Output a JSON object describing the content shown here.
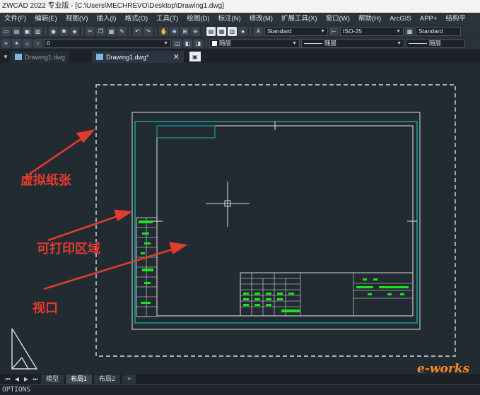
{
  "window": {
    "title": "ZWCAD 2022 专业版 - [C:\\Users\\MECHREVO\\Desktop\\Drawing1.dwg]"
  },
  "menu": [
    "文件(F)",
    "编辑(E)",
    "视图(V)",
    "插入(I)",
    "格式(O)",
    "工具(T)",
    "绘图(D)",
    "标注(N)",
    "修改(M)",
    "扩展工具(X)",
    "窗口(W)",
    "帮助(H)",
    "ArcGIS",
    "APP+",
    "结构平"
  ],
  "toolbar": {
    "text_style": "Standard",
    "dim_style": "ISO-25",
    "table_style": "Standard",
    "layer": "0",
    "color": "随层",
    "linetype": "随层",
    "lineweight": "随层"
  },
  "doc_tabs": [
    {
      "label": "Drawing1.dwg",
      "active": false
    },
    {
      "label": "Drawing1.dwg*",
      "active": true
    }
  ],
  "annotations": {
    "paper": "虚拟纸张",
    "printable": "可打印区域",
    "viewport": "视口"
  },
  "layout_tabs": [
    "模型",
    "布局1",
    "布局2"
  ],
  "command_line": "OPTIONS",
  "watermark": "e-works",
  "colors": {
    "canvas_bg": "#222a32",
    "frame": "#d7dde2",
    "viewport": "#19b4b4",
    "text_green": "#19e619",
    "annotation_red": "#e23b2e"
  }
}
